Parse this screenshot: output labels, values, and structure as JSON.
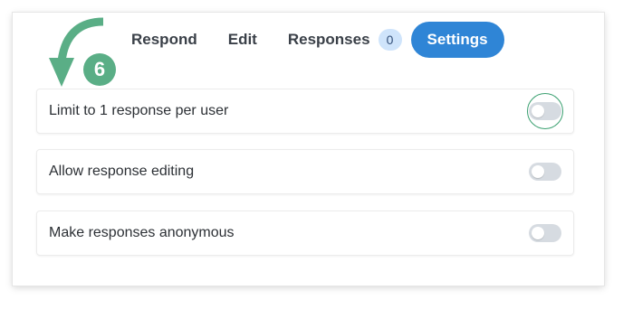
{
  "tabs": {
    "respond": "Respond",
    "edit": "Edit",
    "responses": "Responses",
    "responses_count": "0",
    "settings": "Settings",
    "active": "settings"
  },
  "settings": [
    {
      "label": "Limit to 1 response per user",
      "enabled": false
    },
    {
      "label": "Allow response editing",
      "enabled": false
    },
    {
      "label": "Make responses anonymous",
      "enabled": false
    }
  ],
  "annotation": {
    "step_number": "6",
    "color": "#5aae86"
  },
  "colors": {
    "accent": "#2f85d6",
    "badge_bg": "#cfe4fb",
    "toggle_off": "#d6dbe1"
  }
}
